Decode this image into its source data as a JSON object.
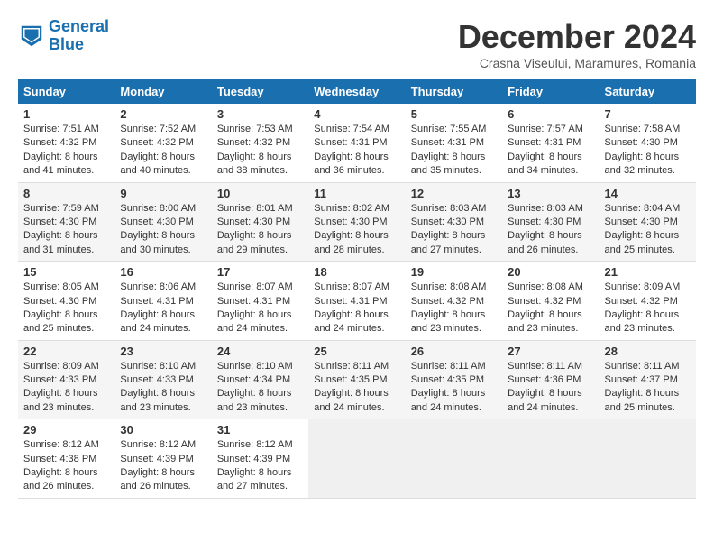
{
  "logo": {
    "text_general": "General",
    "text_blue": "Blue"
  },
  "header": {
    "month_title": "December 2024",
    "subtitle": "Crasna Viseului, Maramures, Romania"
  },
  "weekdays": [
    "Sunday",
    "Monday",
    "Tuesday",
    "Wednesday",
    "Thursday",
    "Friday",
    "Saturday"
  ],
  "weeks": [
    [
      {
        "day": "1",
        "sunrise": "Sunrise: 7:51 AM",
        "sunset": "Sunset: 4:32 PM",
        "daylight": "Daylight: 8 hours and 41 minutes."
      },
      {
        "day": "2",
        "sunrise": "Sunrise: 7:52 AM",
        "sunset": "Sunset: 4:32 PM",
        "daylight": "Daylight: 8 hours and 40 minutes."
      },
      {
        "day": "3",
        "sunrise": "Sunrise: 7:53 AM",
        "sunset": "Sunset: 4:32 PM",
        "daylight": "Daylight: 8 hours and 38 minutes."
      },
      {
        "day": "4",
        "sunrise": "Sunrise: 7:54 AM",
        "sunset": "Sunset: 4:31 PM",
        "daylight": "Daylight: 8 hours and 36 minutes."
      },
      {
        "day": "5",
        "sunrise": "Sunrise: 7:55 AM",
        "sunset": "Sunset: 4:31 PM",
        "daylight": "Daylight: 8 hours and 35 minutes."
      },
      {
        "day": "6",
        "sunrise": "Sunrise: 7:57 AM",
        "sunset": "Sunset: 4:31 PM",
        "daylight": "Daylight: 8 hours and 34 minutes."
      },
      {
        "day": "7",
        "sunrise": "Sunrise: 7:58 AM",
        "sunset": "Sunset: 4:30 PM",
        "daylight": "Daylight: 8 hours and 32 minutes."
      }
    ],
    [
      {
        "day": "8",
        "sunrise": "Sunrise: 7:59 AM",
        "sunset": "Sunset: 4:30 PM",
        "daylight": "Daylight: 8 hours and 31 minutes."
      },
      {
        "day": "9",
        "sunrise": "Sunrise: 8:00 AM",
        "sunset": "Sunset: 4:30 PM",
        "daylight": "Daylight: 8 hours and 30 minutes."
      },
      {
        "day": "10",
        "sunrise": "Sunrise: 8:01 AM",
        "sunset": "Sunset: 4:30 PM",
        "daylight": "Daylight: 8 hours and 29 minutes."
      },
      {
        "day": "11",
        "sunrise": "Sunrise: 8:02 AM",
        "sunset": "Sunset: 4:30 PM",
        "daylight": "Daylight: 8 hours and 28 minutes."
      },
      {
        "day": "12",
        "sunrise": "Sunrise: 8:03 AM",
        "sunset": "Sunset: 4:30 PM",
        "daylight": "Daylight: 8 hours and 27 minutes."
      },
      {
        "day": "13",
        "sunrise": "Sunrise: 8:03 AM",
        "sunset": "Sunset: 4:30 PM",
        "daylight": "Daylight: 8 hours and 26 minutes."
      },
      {
        "day": "14",
        "sunrise": "Sunrise: 8:04 AM",
        "sunset": "Sunset: 4:30 PM",
        "daylight": "Daylight: 8 hours and 25 minutes."
      }
    ],
    [
      {
        "day": "15",
        "sunrise": "Sunrise: 8:05 AM",
        "sunset": "Sunset: 4:30 PM",
        "daylight": "Daylight: 8 hours and 25 minutes."
      },
      {
        "day": "16",
        "sunrise": "Sunrise: 8:06 AM",
        "sunset": "Sunset: 4:31 PM",
        "daylight": "Daylight: 8 hours and 24 minutes."
      },
      {
        "day": "17",
        "sunrise": "Sunrise: 8:07 AM",
        "sunset": "Sunset: 4:31 PM",
        "daylight": "Daylight: 8 hours and 24 minutes."
      },
      {
        "day": "18",
        "sunrise": "Sunrise: 8:07 AM",
        "sunset": "Sunset: 4:31 PM",
        "daylight": "Daylight: 8 hours and 24 minutes."
      },
      {
        "day": "19",
        "sunrise": "Sunrise: 8:08 AM",
        "sunset": "Sunset: 4:32 PM",
        "daylight": "Daylight: 8 hours and 23 minutes."
      },
      {
        "day": "20",
        "sunrise": "Sunrise: 8:08 AM",
        "sunset": "Sunset: 4:32 PM",
        "daylight": "Daylight: 8 hours and 23 minutes."
      },
      {
        "day": "21",
        "sunrise": "Sunrise: 8:09 AM",
        "sunset": "Sunset: 4:32 PM",
        "daylight": "Daylight: 8 hours and 23 minutes."
      }
    ],
    [
      {
        "day": "22",
        "sunrise": "Sunrise: 8:09 AM",
        "sunset": "Sunset: 4:33 PM",
        "daylight": "Daylight: 8 hours and 23 minutes."
      },
      {
        "day": "23",
        "sunrise": "Sunrise: 8:10 AM",
        "sunset": "Sunset: 4:33 PM",
        "daylight": "Daylight: 8 hours and 23 minutes."
      },
      {
        "day": "24",
        "sunrise": "Sunrise: 8:10 AM",
        "sunset": "Sunset: 4:34 PM",
        "daylight": "Daylight: 8 hours and 23 minutes."
      },
      {
        "day": "25",
        "sunrise": "Sunrise: 8:11 AM",
        "sunset": "Sunset: 4:35 PM",
        "daylight": "Daylight: 8 hours and 24 minutes."
      },
      {
        "day": "26",
        "sunrise": "Sunrise: 8:11 AM",
        "sunset": "Sunset: 4:35 PM",
        "daylight": "Daylight: 8 hours and 24 minutes."
      },
      {
        "day": "27",
        "sunrise": "Sunrise: 8:11 AM",
        "sunset": "Sunset: 4:36 PM",
        "daylight": "Daylight: 8 hours and 24 minutes."
      },
      {
        "day": "28",
        "sunrise": "Sunrise: 8:11 AM",
        "sunset": "Sunset: 4:37 PM",
        "daylight": "Daylight: 8 hours and 25 minutes."
      }
    ],
    [
      {
        "day": "29",
        "sunrise": "Sunrise: 8:12 AM",
        "sunset": "Sunset: 4:38 PM",
        "daylight": "Daylight: 8 hours and 26 minutes."
      },
      {
        "day": "30",
        "sunrise": "Sunrise: 8:12 AM",
        "sunset": "Sunset: 4:39 PM",
        "daylight": "Daylight: 8 hours and 26 minutes."
      },
      {
        "day": "31",
        "sunrise": "Sunrise: 8:12 AM",
        "sunset": "Sunset: 4:39 PM",
        "daylight": "Daylight: 8 hours and 27 minutes."
      },
      null,
      null,
      null,
      null
    ]
  ]
}
